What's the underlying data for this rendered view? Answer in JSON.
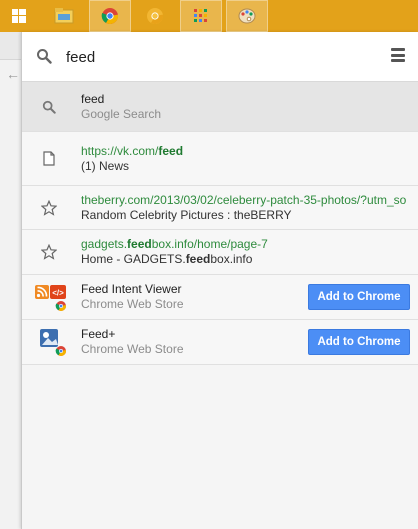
{
  "omnibox": {
    "query": "feed"
  },
  "suggestions": [
    {
      "type": "search",
      "icon": "search-icon",
      "title": "feed",
      "subtitle": "Google Search"
    },
    {
      "type": "history",
      "icon": "page-icon",
      "url_pre": "https://vk.com/",
      "url_hl": "feed",
      "url_post": "",
      "title_pre": "(1) News",
      "title_hl": "",
      "title_post": ""
    },
    {
      "type": "bookmark",
      "icon": "star-icon",
      "url_pre": "theberry.com/2013/03/02/celeberry-patch-35-photos/?utm_so",
      "url_hl": "",
      "url_post": "",
      "title_pre": "Random Celebrity Pictures : theBERRY",
      "title_hl": "",
      "title_post": ""
    },
    {
      "type": "bookmark",
      "icon": "star-icon",
      "url_pre": "gadgets.",
      "url_hl": "feed",
      "url_post": "box.info/home/page-7",
      "title_pre": "Home - GADGETS.",
      "title_hl": "feed",
      "title_post": "box.info"
    }
  ],
  "apps": [
    {
      "icon": "feed-intent-viewer-icon",
      "name": "Feed Intent Viewer",
      "source": "Chrome Web Store",
      "button_label": "Add to Chrome"
    },
    {
      "icon": "feed-plus-icon",
      "name": "Feed+",
      "source": "Chrome Web Store",
      "button_label": "Add to Chrome"
    }
  ],
  "colors": {
    "taskbar": "#e3a21a",
    "url_green": "#2e8b3d",
    "button_blue": "#4c8ef5"
  }
}
